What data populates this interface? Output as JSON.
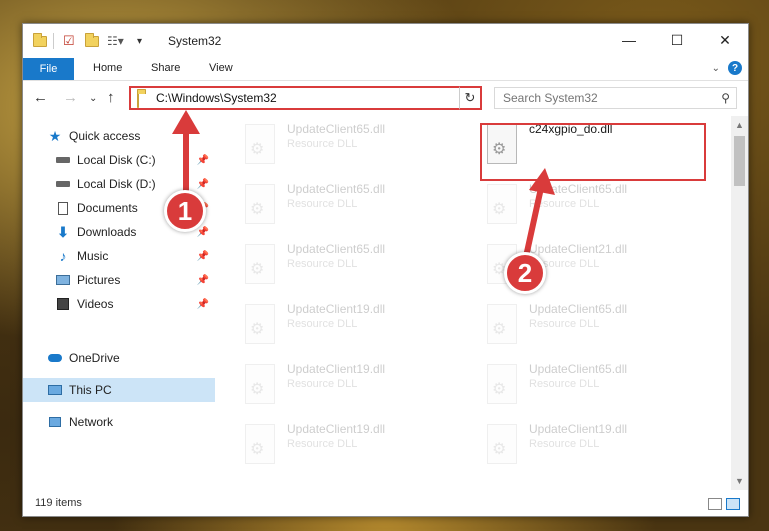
{
  "window": {
    "title": "System32",
    "buttons": {
      "minimize": "—",
      "maximize": "☐",
      "close": "✕"
    }
  },
  "ribbon": {
    "tabs": [
      "File",
      "Home",
      "Share",
      "View"
    ],
    "help": "?"
  },
  "address": {
    "path": "C:\\Windows\\System32"
  },
  "search": {
    "placeholder": "Search System32"
  },
  "sidebar": {
    "items": [
      {
        "label": "Quick access",
        "icon": "star-icon"
      },
      {
        "label": "Local Disk (C:)",
        "icon": "drive-icon",
        "pinned": true
      },
      {
        "label": "Local Disk (D:)",
        "icon": "drive-icon",
        "pinned": true
      },
      {
        "label": "Documents",
        "icon": "documents-icon",
        "pinned": true
      },
      {
        "label": "Downloads",
        "icon": "downloads-icon",
        "pinned": true
      },
      {
        "label": "Music",
        "icon": "music-icon",
        "pinned": true
      },
      {
        "label": "Pictures",
        "icon": "pictures-icon",
        "pinned": true
      },
      {
        "label": "Videos",
        "icon": "videos-icon",
        "pinned": true
      },
      {
        "label": "OneDrive",
        "icon": "cloud-icon"
      },
      {
        "label": "This PC",
        "icon": "computer-icon",
        "selected": true
      },
      {
        "label": "Network",
        "icon": "network-icon"
      }
    ]
  },
  "files": [
    {
      "name": "UpdateClient65.dll",
      "type": "Resource DLL"
    },
    {
      "name": "c24xgpio_do.dll",
      "type": ""
    },
    {
      "name": "UpdateClient65.dll",
      "type": "Resource DLL"
    },
    {
      "name": "UpdateClient65.dll",
      "type": "Resource DLL"
    },
    {
      "name": "UpdateClient65.dll",
      "type": "Resource DLL"
    },
    {
      "name": "UpdateClient21.dll",
      "type": "Resource DLL"
    },
    {
      "name": "UpdateClient19.dll",
      "type": "Resource DLL"
    },
    {
      "name": "UpdateClient65.dll",
      "type": "Resource DLL"
    },
    {
      "name": "UpdateClient19.dll",
      "type": "Resource DLL"
    },
    {
      "name": "UpdateClient65.dll",
      "type": "Resource DLL"
    },
    {
      "name": "UpdateClient19.dll",
      "type": "Resource DLL"
    },
    {
      "name": "UpdateClient19.dll",
      "type": "Resource DLL"
    }
  ],
  "status": {
    "item_count": "119 items"
  },
  "annotations": {
    "marker1": "1",
    "marker2": "2"
  },
  "colors": {
    "accent": "#1979ca",
    "highlight": "#d93b3b",
    "selection": "#cce4f7"
  }
}
